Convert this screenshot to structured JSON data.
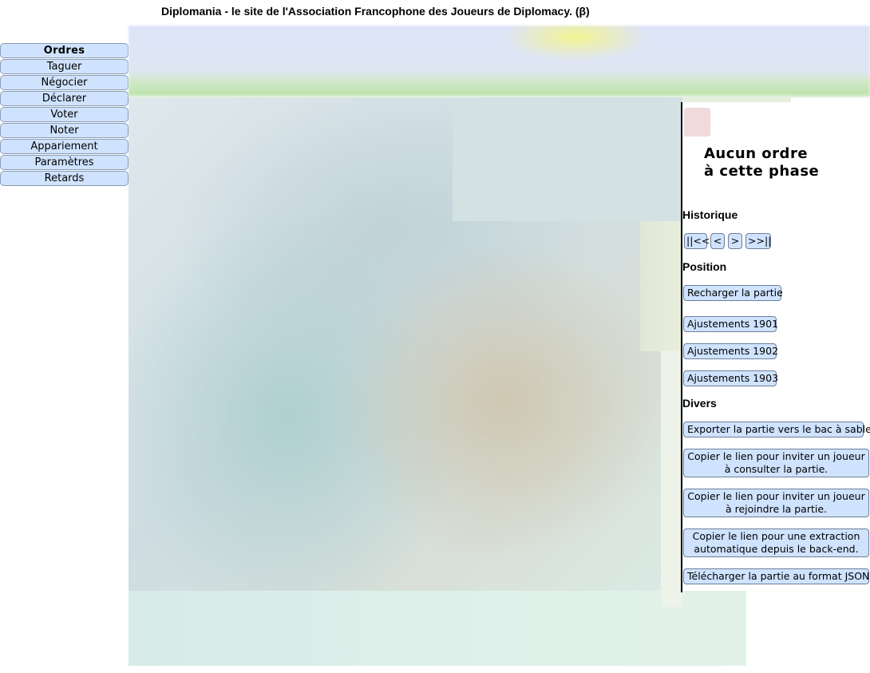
{
  "header": {
    "title": "Diplomania - le site de l'Association Francophone des Joueurs de Diplomacy. (β)"
  },
  "menu": {
    "items": [
      {
        "label": "Ordres",
        "active": true
      },
      {
        "label": "Taguer"
      },
      {
        "label": "Négocier"
      },
      {
        "label": "Déclarer"
      },
      {
        "label": "Voter"
      },
      {
        "label": "Noter"
      },
      {
        "label": "Appariement"
      },
      {
        "label": "Paramètres"
      },
      {
        "label": "Retards"
      }
    ]
  },
  "orders_panel": {
    "message": "Aucun ordre\nà cette phase"
  },
  "history": {
    "title": "Historique",
    "nav": {
      "first": "||<<",
      "prev": "<",
      "next": ">",
      "last": ">>||"
    }
  },
  "position": {
    "title": "Position",
    "reload": "Recharger la partie",
    "adjustments": [
      "Ajustements 1901",
      "Ajustements 1902",
      "Ajustements 1903"
    ]
  },
  "misc": {
    "title": "Divers",
    "export_sandbox": "Exporter la partie vers le bac à sable",
    "invite_view": "Copier le lien pour inviter un joueur à consulter la partie.",
    "invite_join": "Copier le lien pour inviter un joueur à rejoindre la partie.",
    "backend_link": "Copier le lien pour une extraction automatique depuis le back-end.",
    "download_json": "Télécharger la partie au format JSON"
  },
  "colors": {
    "button_bg": "#cfe3ff",
    "banner_highlight": "#f5f58c"
  }
}
